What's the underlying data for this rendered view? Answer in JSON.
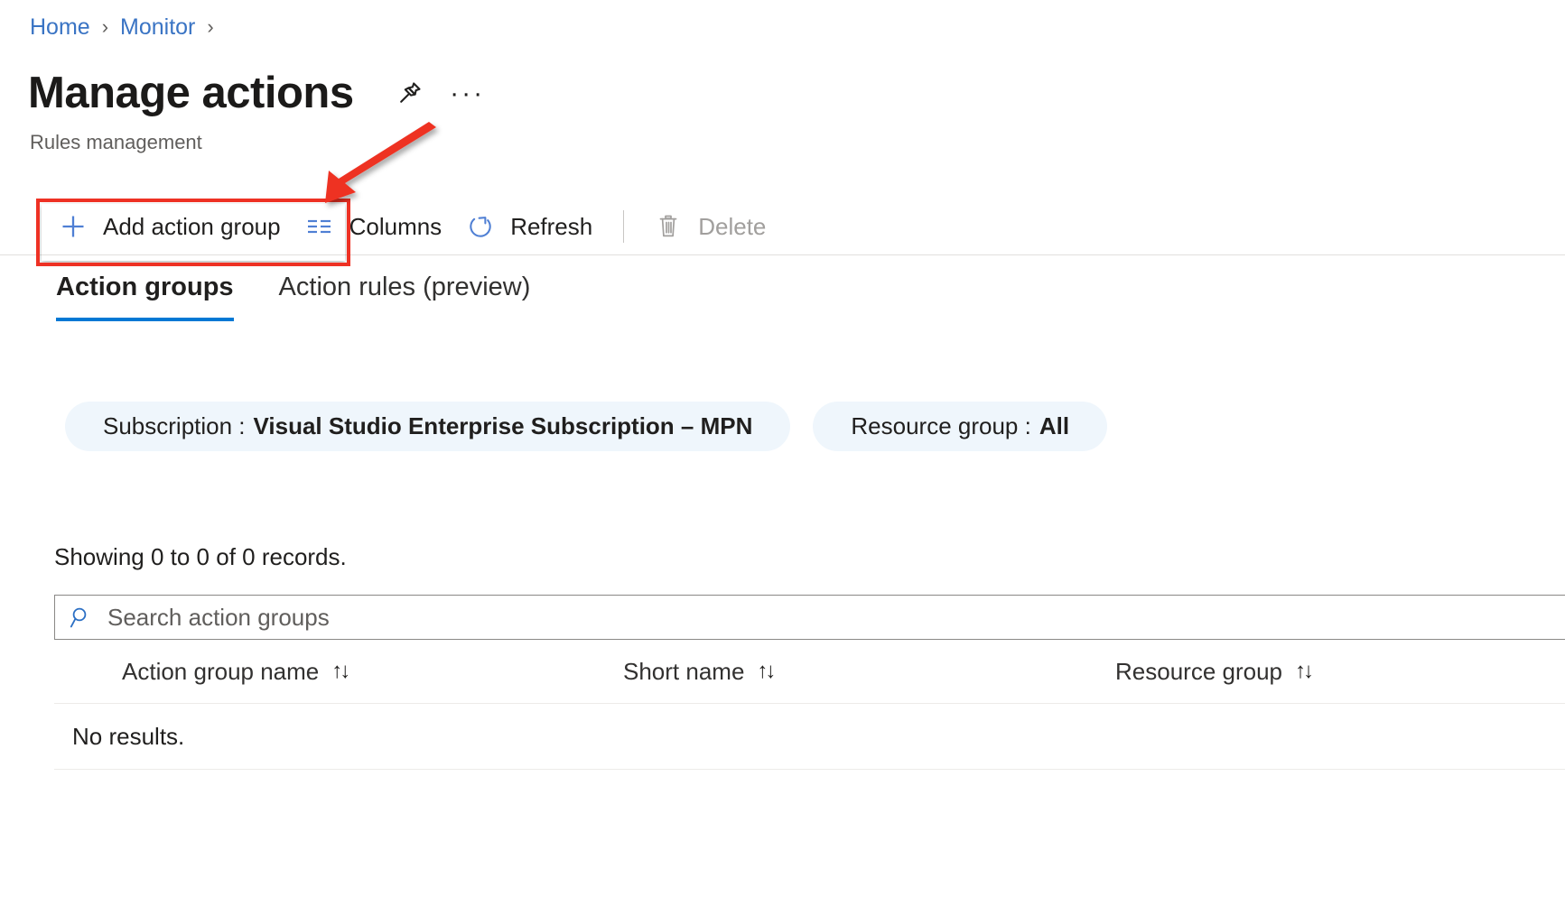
{
  "breadcrumb": {
    "items": [
      {
        "label": "Home",
        "separator": "›"
      },
      {
        "label": "Monitor",
        "separator": "›"
      }
    ],
    "sep1": "›",
    "sep2": "›"
  },
  "header": {
    "title": "Manage actions",
    "subtitle": "Rules management",
    "pin_icon": "pin-icon",
    "more_icon": "···"
  },
  "toolbar": {
    "add_label": "Add action group",
    "add_icon": "plus-icon",
    "columns_label": "Columns",
    "columns_icon": "columns-icon",
    "refresh_label": "Refresh",
    "refresh_icon": "refresh-icon",
    "delete_label": "Delete",
    "delete_icon": "trash-icon",
    "delete_disabled": true
  },
  "tabs": [
    {
      "label": "Action groups",
      "active": true
    },
    {
      "label": "Action rules (preview)",
      "active": false
    }
  ],
  "filters": [
    {
      "label": "Subscription :",
      "value": "Visual Studio Enterprise Subscription – MPN"
    },
    {
      "label": "Resource group :",
      "value": "All"
    }
  ],
  "list": {
    "records_text": "Showing 0 to 0 of 0 records.",
    "search_placeholder": "Search action groups",
    "search_value": "",
    "search_icon": "search-icon",
    "columns": [
      {
        "label": "Action group name",
        "sort": "↑↓"
      },
      {
        "label": "Short name",
        "sort": "↑↓"
      },
      {
        "label": "Resource group",
        "sort": "↑↓"
      }
    ],
    "empty_text": "No results."
  },
  "annotation": {
    "arrow_color": "#ee3124",
    "box_color": "#ee3124"
  },
  "colors": {
    "link": "#3a74c4",
    "accent": "#0078d4",
    "pill_bg": "#eff6fc",
    "disabled": "#a19f9d"
  }
}
